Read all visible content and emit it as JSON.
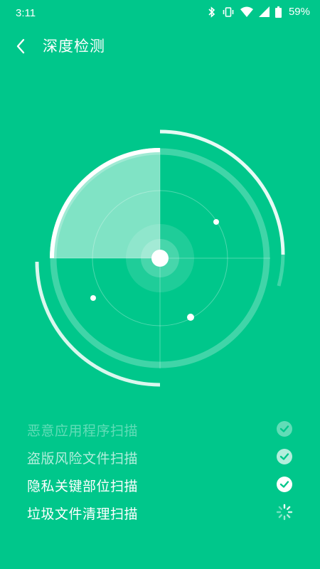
{
  "status_bar": {
    "time": "3:11",
    "battery": "59%",
    "icons": [
      "bluetooth-icon",
      "vibrate-icon",
      "wifi-icon",
      "signal-icon",
      "battery-icon"
    ]
  },
  "header": {
    "title": "深度检测",
    "back_icon": "chevron-left-icon"
  },
  "colors": {
    "background": "#00c78b",
    "foreground": "#ffffff"
  },
  "scan_items": [
    {
      "label": "恶意应用程序扫描",
      "status": "done"
    },
    {
      "label": "盗版风险文件扫描",
      "status": "done"
    },
    {
      "label": "隐私关键部位扫描",
      "status": "done"
    },
    {
      "label": "垃圾文件清理扫描",
      "status": "scanning"
    }
  ]
}
